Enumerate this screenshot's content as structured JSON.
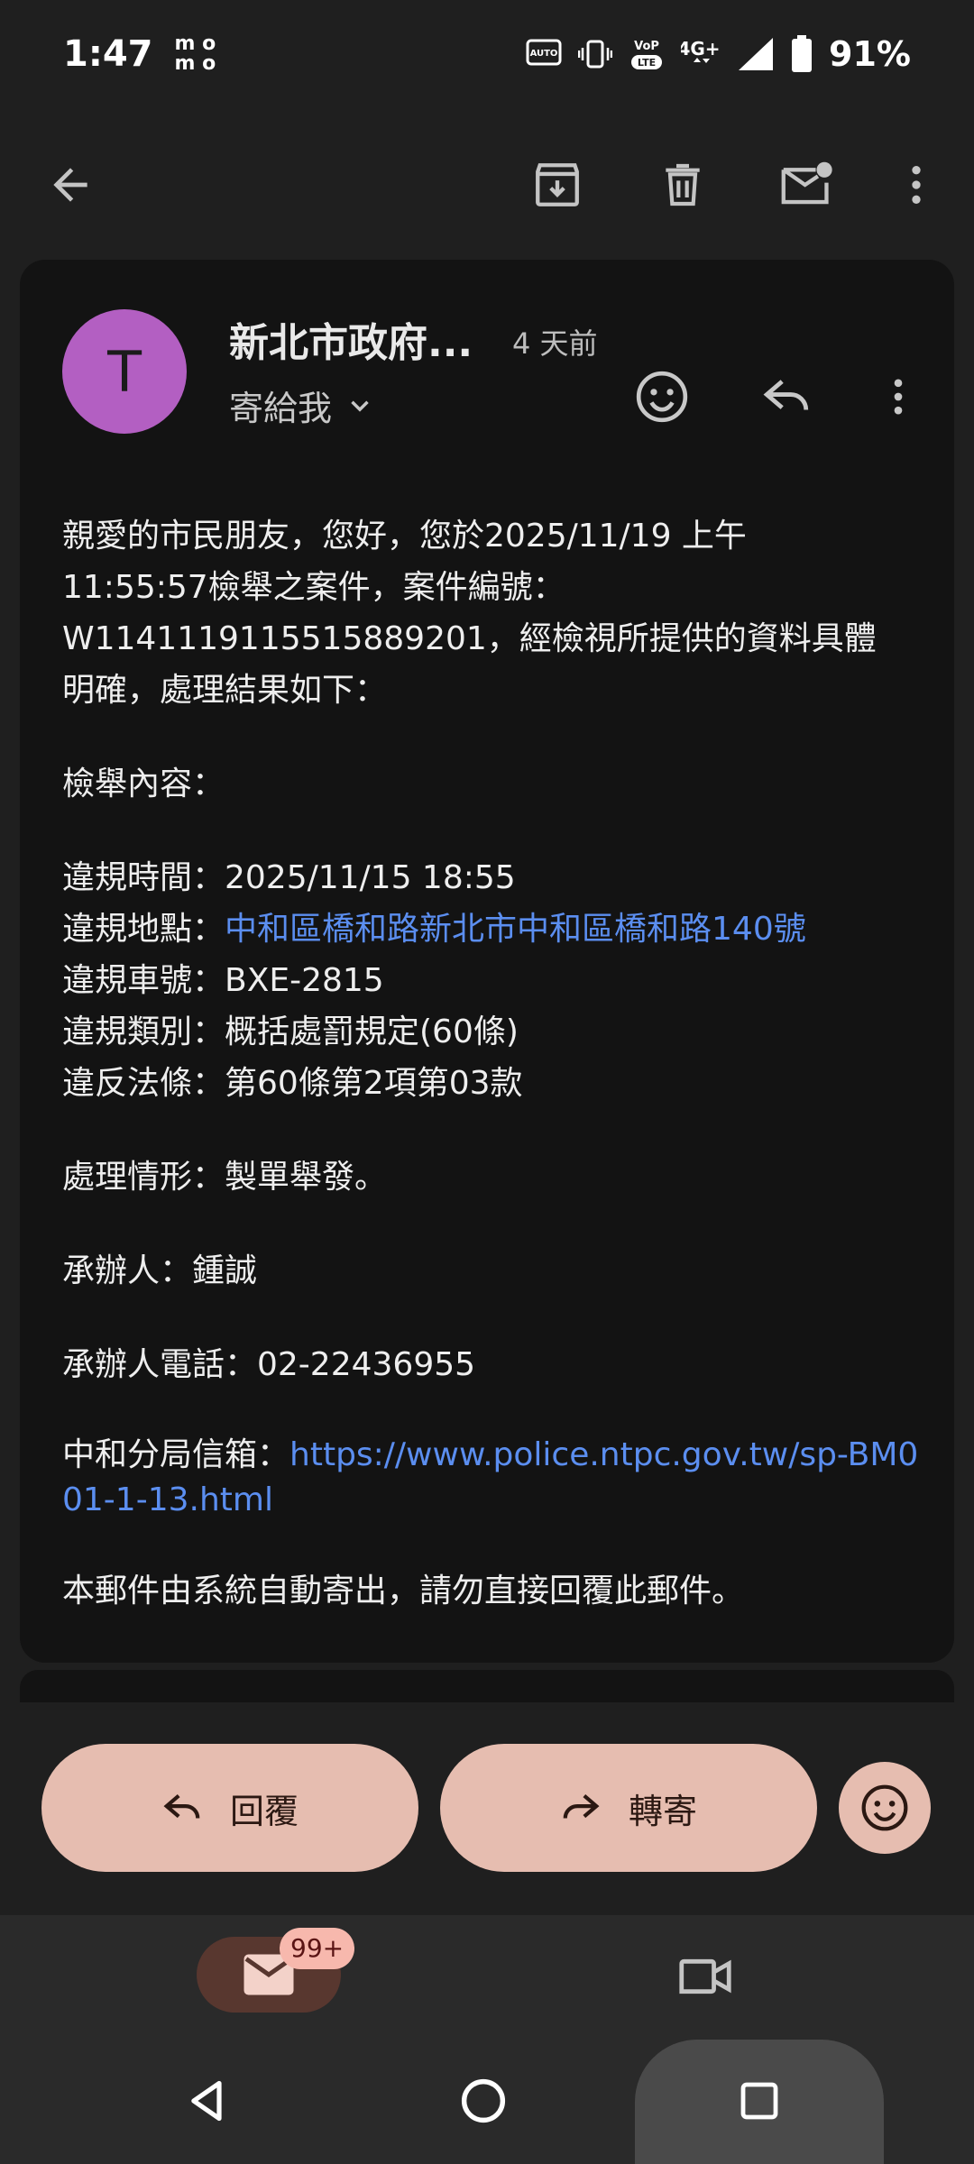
{
  "status_bar": {
    "time": "1:47",
    "carrier_badge": "mo\nmo",
    "battery": "91%",
    "colors": {
      "text": "#ffffff"
    }
  },
  "app_bar": {
    "back_icon": "arrow-left-icon",
    "archive_icon": "archive-icon",
    "delete_icon": "trash-icon",
    "mark_unread_icon": "mail-unread-icon",
    "more_icon": "more-vert-icon"
  },
  "email": {
    "avatar_letter": "T",
    "avatar_color": "#b35fc2",
    "sender": "新北市政府...",
    "time": "4 天前",
    "recipient": "寄給我",
    "body": {
      "intro_1": "親愛的市民朋友，您好，您於2025/11/19 上午",
      "intro_2": "11:55:57檢舉之案件，案件編號：",
      "intro_3": "W1141119115515889201，經檢視所提供的資料具體",
      "intro_4": "明確，處理結果如下：",
      "content_heading": "檢舉內容：",
      "violation_time": "違規時間：2025/11/15 18:55",
      "violation_place_label": "違規地點：",
      "violation_place_link": "中和區橋和路新北市中和區橋和路140號",
      "plate": "違規車號：BXE-2815",
      "category": "違規類別：概括處罰規定(60條)",
      "law": "違反法條：第60條第2項第03款",
      "handling": "處理情形：製單舉發。",
      "officer": "承辦人：鍾誠",
      "officer_phone": "承辦人電話：02-22436955",
      "mailbox_label": "中和分局信箱：",
      "mailbox_link": "https://www.police.ntpc.gov.tw/sp-BM001-1-13.html",
      "footer": "本郵件由系統自動寄出，請勿直接回覆此郵件。"
    },
    "link_color": "#5b8ef0"
  },
  "actions": {
    "reply": "回覆",
    "forward": "轉寄",
    "button_color": "#e6bdb0"
  },
  "bottom_nav": {
    "mail_badge": "99+",
    "mail_icon": "mail-icon",
    "meet_icon": "video-icon"
  }
}
